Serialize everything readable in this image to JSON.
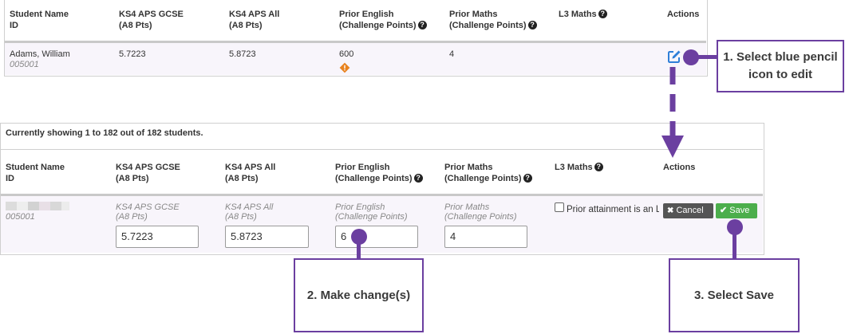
{
  "table1": {
    "headers": {
      "student": "Student Name",
      "student_id": "ID",
      "ks4_gcse": "KS4 APS GCSE",
      "ks4_gcse_sub": "(A8 Pts)",
      "ks4_all": "KS4 APS All",
      "ks4_all_sub": "(A8 Pts)",
      "prior_english": "Prior English",
      "prior_english_sub": "(Challenge Points)",
      "prior_maths": "Prior Maths",
      "prior_maths_sub": "(Challenge Points)",
      "l3_maths": "L3 Maths",
      "actions": "Actions"
    },
    "row": {
      "name": "Adams, William",
      "id": "005001",
      "ks4_gcse": "5.7223",
      "ks4_all": "5.8723",
      "prior_english": "600",
      "prior_maths": "4"
    }
  },
  "table2": {
    "status": "Currently showing 1 to 182 out of 182 students.",
    "headers": {
      "student": "Student Name",
      "student_id": "ID",
      "ks4_gcse": "KS4 APS GCSE",
      "ks4_gcse_sub": "(A8 Pts)",
      "ks4_all": "KS4 APS All",
      "ks4_all_sub": "(A8 Pts)",
      "prior_english": "Prior English",
      "prior_english_sub": "(Challenge Points)",
      "prior_maths": "Prior Maths",
      "prior_maths_sub": "(Challenge Points)",
      "l3_maths": "L3 Maths",
      "actions": "Actions"
    },
    "row": {
      "id": "005001",
      "ks4_gcse_label": "KS4 APS GCSE",
      "ks4_gcse_label_sub": "(A8 Pts)",
      "ks4_gcse_value": "5.7223",
      "ks4_all_label": "KS4 APS All",
      "ks4_all_label_sub": "(A8 Pts)",
      "ks4_all_value": "5.8723",
      "prior_english_label": "Prior English",
      "prior_english_label_sub": "(Challenge Points)",
      "prior_english_value": "6",
      "prior_maths_label": "Prior Maths",
      "prior_maths_label_sub": "(Challenge Points)",
      "prior_maths_value": "4",
      "checkbox_label": "Prior attainment is an L",
      "cancel_label": "Cancel",
      "save_label": "Save"
    }
  },
  "callouts": {
    "step1_line1": "1. Select blue pencil",
    "step1_line2": "icon to edit",
    "step2": "2. Make change(s)",
    "step3": "3. Select Save"
  },
  "colors": {
    "accent_purple": "#6b3fa0",
    "pencil_blue": "#2f7fd8",
    "save_green": "#4cae4c",
    "cancel_gray": "#555555",
    "warning_orange": "#e8821e"
  }
}
